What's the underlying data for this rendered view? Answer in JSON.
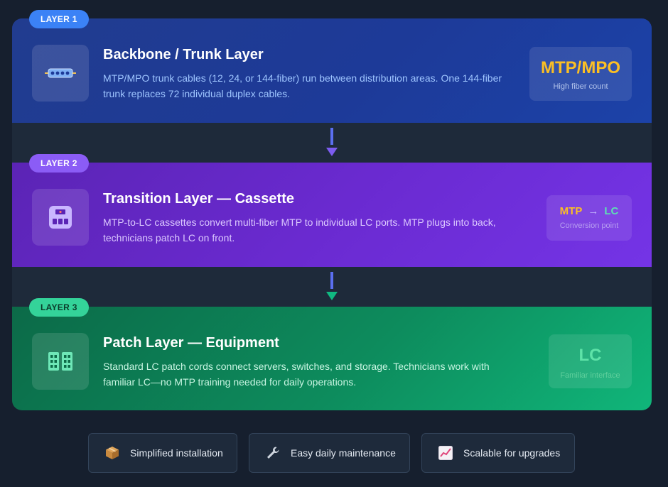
{
  "layers": [
    {
      "badge": "LAYER 1",
      "title": "Backbone / Trunk Layer",
      "description": "MTP/MPO trunk cables (12, 24, or 144-fiber) run between distribution areas. One 144-fiber trunk replaces 72 individual duplex cables.",
      "side_main": "MTP/MPO",
      "side_sub": "High fiber count",
      "icon": "trunk-cable-icon"
    },
    {
      "badge": "LAYER 2",
      "title": "Transition Layer — Cassette",
      "description": "MTP-to-LC cassettes convert multi-fiber MTP to individual LC ports. MTP plugs into back, technicians patch LC on front.",
      "side_from": "MTP",
      "side_arrow": "→",
      "side_to": "LC",
      "side_sub": "Conversion point",
      "icon": "cassette-icon"
    },
    {
      "badge": "LAYER 3",
      "title": "Patch Layer — Equipment",
      "description": "Standard LC patch cords connect servers, switches, and storage. Technicians work with familiar LC—no MTP training needed for daily operations.",
      "side_main": "LC",
      "side_sub": "Familiar interface",
      "icon": "lc-ports-icon"
    }
  ],
  "features": [
    {
      "label": "Simplified installation",
      "icon": "package-icon"
    },
    {
      "label": "Easy daily maintenance",
      "icon": "wrench-icon"
    },
    {
      "label": "Scalable for upgrades",
      "icon": "chart-up-icon"
    }
  ],
  "colors": {
    "layer1": "#1d3a98",
    "layer2": "#6a2ad0",
    "layer3": "#0d8c5d",
    "accent_amber": "#fbbf24",
    "accent_green": "#34d399",
    "background": "#161f2e"
  }
}
